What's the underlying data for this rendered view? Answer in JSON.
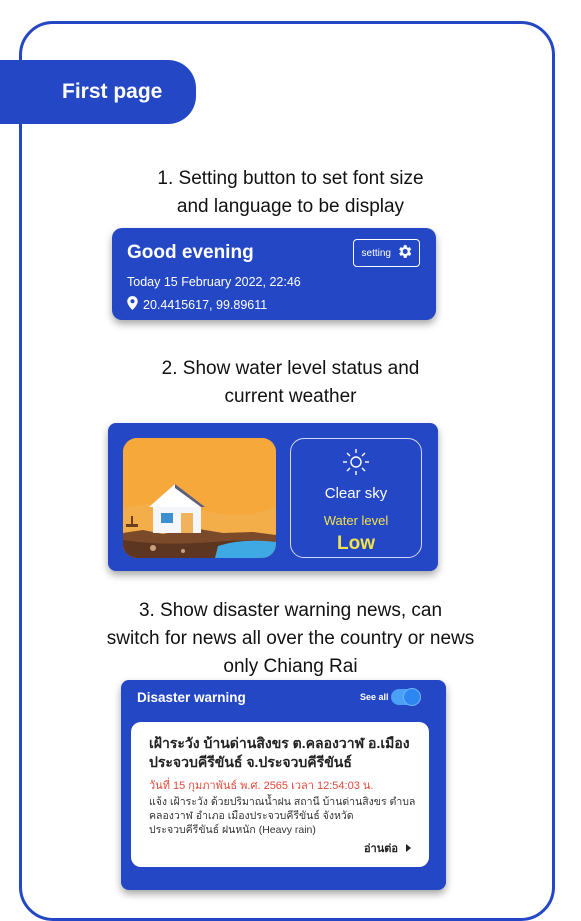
{
  "tag": {
    "label": "First page"
  },
  "captions": {
    "c1_l1": "1. Setting button to set font size",
    "c1_l2": "and language to be display",
    "c2_l1": "2. Show water level status and",
    "c2_l2": "current weather",
    "c3_l1": "3. Show disaster warning news, can",
    "c3_l2": "switch for news all over the country or news",
    "c3_l3": "only Chiang Rai"
  },
  "home_card": {
    "greeting": "Good evening",
    "setting_label": "setting",
    "date": "Today 15 February 2022, 22:46",
    "location": "20.4415617, 99.89611"
  },
  "status_card": {
    "weather": "Clear sky",
    "water_label": "Water level",
    "water_value": "Low"
  },
  "warning_card": {
    "title": "Disaster warning",
    "see_all": "See all",
    "toggle_on": true,
    "news": {
      "headline": "เฝ้าระวัง บ้านด่านสิงขร ต.คลองวาฬ อ.เมือง ประจวบคีรีขันธ์ จ.ประจวบคีรีขันธ์",
      "datetime": "วันที่ 15 กุมภาพันธ์ พ.ศ. 2565 เวลา 12:54:03 น.",
      "body": "แจ้ง เฝ้าระวัง ด้วยปริมาณน้ำฝน สถานี บ้านด่านสิงขร ตำบล คลองวาฬ อำเภอ เมืองประจวบคีรีขันธ์ จังหวัด ประจวบคีรีขันธ์ ฝนหนัก (Heavy rain)",
      "read_more": "อ่านต่อ"
    }
  },
  "colors": {
    "primary": "#2447c5",
    "accent_yellow": "#f3e24a",
    "date_red": "#e24a3c"
  }
}
